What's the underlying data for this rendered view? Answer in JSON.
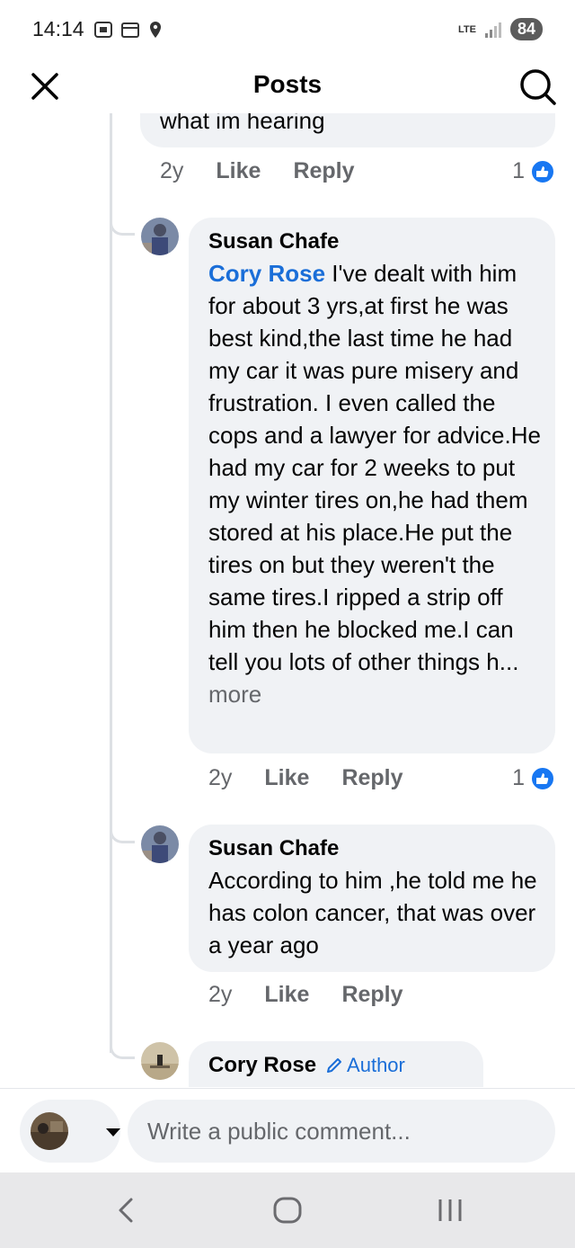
{
  "status": {
    "time": "14:14",
    "network": "LTE",
    "battery": "84"
  },
  "header": {
    "title": "Posts"
  },
  "comments": [
    {
      "partial_text": "what im hearing",
      "age": "2y",
      "like_label": "Like",
      "reply_label": "Reply",
      "reaction_count": "1"
    },
    {
      "author": "Susan Chafe",
      "mention": "Cory Rose",
      "text": " I've dealt with him for about 3 yrs,at first he was best kind,the last time he had my car it was pure misery and frustration. I even called the cops and a lawyer for advice.He had my car for 2 weeks to put my winter tires on,he had them stored at his place.He put the tires on but they weren't the same tires.I ripped a strip off him then he blocked me.I can tell you lots of other things h...",
      "more_label": " more",
      "age": "2y",
      "like_label": "Like",
      "reply_label": "Reply",
      "reaction_count": "1"
    },
    {
      "author": "Susan Chafe",
      "text": "According to him ,he told me he has colon cancer, that was over a year ago",
      "age": "2y",
      "like_label": "Like",
      "reply_label": "Reply"
    },
    {
      "author": "Cory Rose",
      "badge": "Author"
    }
  ],
  "composer": {
    "placeholder": "Write a public comment..."
  },
  "colors": {
    "accent": "#1877f2",
    "mention": "#1a6ed8",
    "bubble": "#f0f2f5",
    "secondary_text": "#65676b"
  }
}
